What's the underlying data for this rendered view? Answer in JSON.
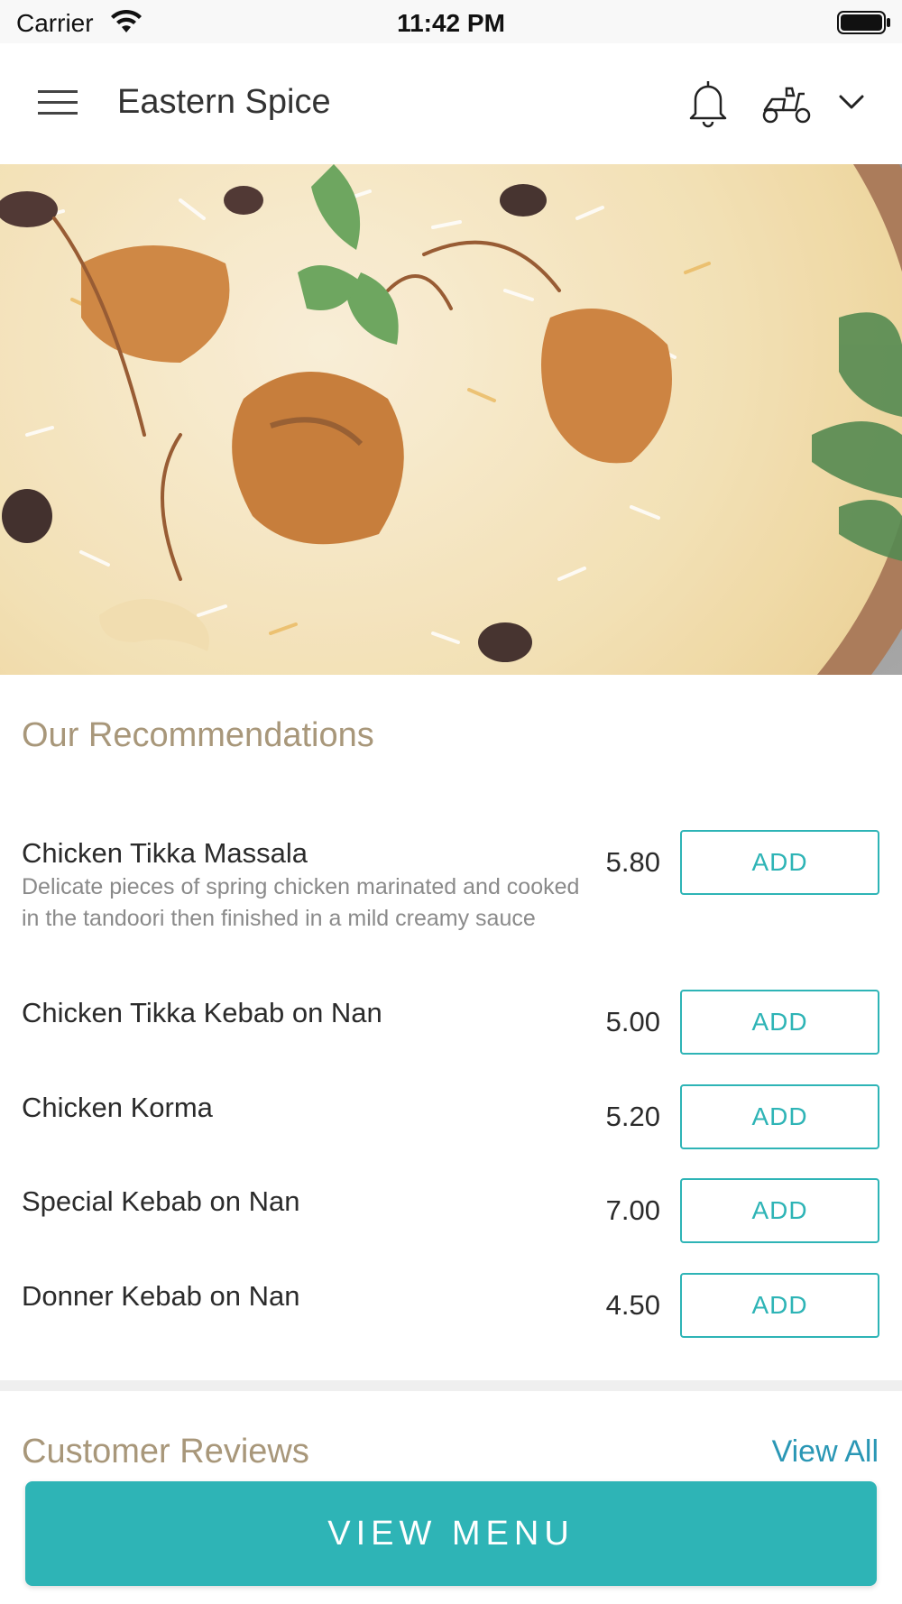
{
  "status_bar": {
    "carrier": "Carrier",
    "time": "11:42 PM"
  },
  "header": {
    "title": "Eastern Spice",
    "icons": [
      "menu-icon",
      "bell-icon",
      "scooter-icon",
      "chevron-down-icon"
    ]
  },
  "hero": {
    "image": "biryani-dish-photo"
  },
  "recommendations": {
    "heading": "Our Recommendations",
    "items": [
      {
        "name": "Chicken Tikka Massala",
        "description": "Delicate pieces of spring chicken marinated and cooked in the tandoori then finished in a mild creamy sauce",
        "price": "5.80",
        "button": "ADD"
      },
      {
        "name": "Chicken Tikka Kebab on Nan",
        "price": "5.00",
        "button": "ADD"
      },
      {
        "name": "Chicken Korma",
        "price": "5.20",
        "button": "ADD"
      },
      {
        "name": "Special Kebab on Nan",
        "price": "7.00",
        "button": "ADD"
      },
      {
        "name": "Donner Kebab on Nan",
        "price": "4.50",
        "button": "ADD"
      }
    ]
  },
  "reviews": {
    "heading": "Customer Reviews",
    "view_all": "View All"
  },
  "footer": {
    "view_menu": "VIEW MENU"
  },
  "colors": {
    "accent_teal": "#2eb4b6",
    "heading_tan": "#a8977a",
    "link_blue": "#2a97b5"
  }
}
